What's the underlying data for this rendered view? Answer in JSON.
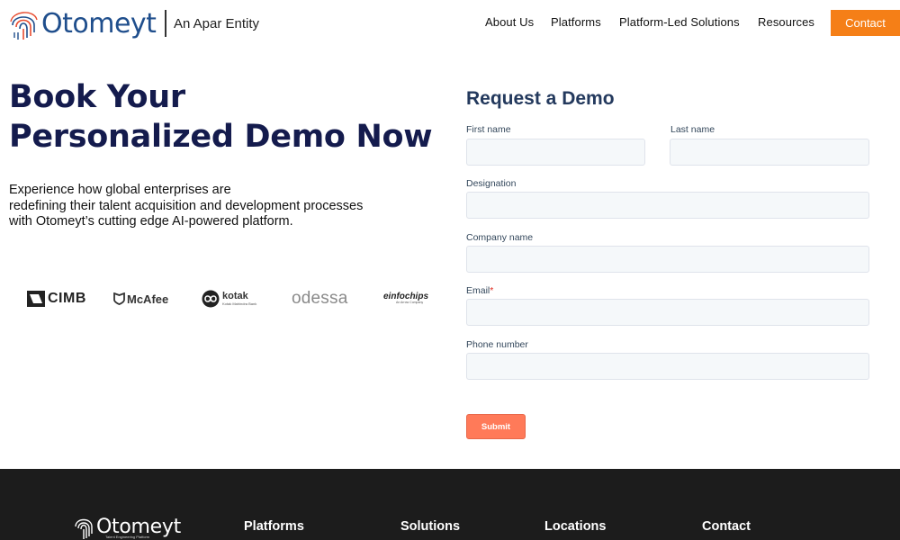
{
  "header": {
    "logo_text": "Otomeyt",
    "logo_entity": "An Apar Entity",
    "nav": {
      "about": "About Us",
      "platforms": "Platforms",
      "solutions": "Platform-Led Solutions",
      "resources": "Resources"
    },
    "contact_label": "Contact"
  },
  "hero": {
    "title_line1": "Book Your",
    "title_line2": "Personalized Demo Now",
    "desc_line1": "Experience how global enterprises are",
    "desc_line2": "redefining their talent acquisition and development processes",
    "desc_line3": "with Otomeyt’s cutting edge AI-powered platform."
  },
  "clients": {
    "cimb": "CIMB",
    "mcafee": "McAfee",
    "kotak": "kotak",
    "kotak_sub": "Kotak Mahindra Bank",
    "odessa": "odessa",
    "einfochips": "einfochips",
    "einfochips_sub": "An Arrow Company"
  },
  "form": {
    "title": "Request a Demo",
    "first_name_label": "First name",
    "last_name_label": "Last name",
    "designation_label": "Designation",
    "company_label": "Company name",
    "email_label": "Email",
    "email_required_mark": "*",
    "phone_label": "Phone number",
    "submit_label": "Submit"
  },
  "footer": {
    "logo_text": "Otomeyt",
    "tagline": "Talent Engineering Platform",
    "headings": {
      "platforms": "Platforms",
      "solutions": "Solutions",
      "locations": "Locations",
      "contact": "Contact"
    }
  },
  "colors": {
    "brand_blue": "#1f4e8c",
    "heading_navy": "#141b4d",
    "contact_orange": "#f57f17",
    "submit_coral": "#ff7a59",
    "footer_bg": "#1c1c1c"
  },
  "icons": {
    "logo": "fingerprint-logo-icon",
    "cimb": "cimb-logo-icon",
    "mcafee": "mcafee-shield-icon",
    "kotak": "kotak-infinity-icon"
  }
}
